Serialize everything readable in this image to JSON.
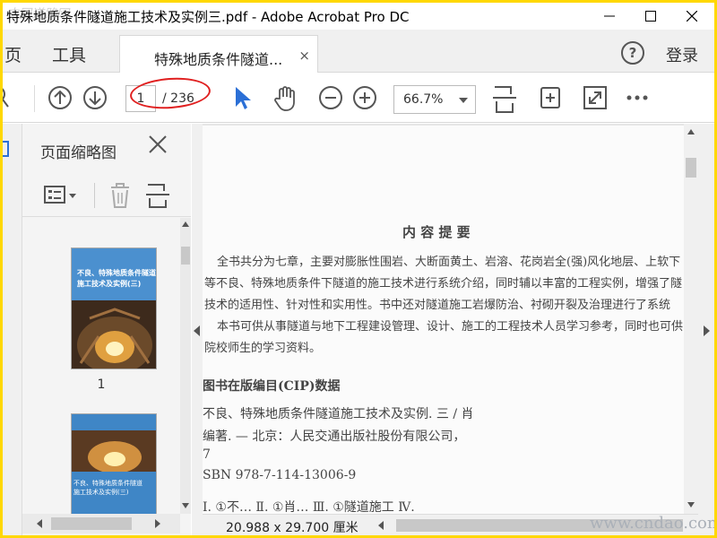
{
  "window": {
    "title": "特殊地质条件隧道施工技术及实例三.pdf - Adobe Acrobat Pro DC"
  },
  "menu": {
    "home": "页",
    "tools": "工具",
    "sign_in": "登录",
    "help": "?"
  },
  "tab": {
    "label": "特殊地质条件隧道...",
    "close": "×"
  },
  "toolbar": {
    "current_page": "1",
    "total_pages": "/ 236",
    "zoom": "66.7%"
  },
  "panel": {
    "title": "页面缩略图",
    "thumbnails": [
      {
        "page": "1",
        "title_line1": "不良、特殊地质条件隧道",
        "title_line2": "施工技术及实例(三)"
      },
      {
        "title_line1": "不良、特殊地质条件隧道",
        "title_line2": "施工技术及实例(三)"
      }
    ]
  },
  "document": {
    "heading": "内  容  提  要",
    "summary_lines": [
      "全书共分为七章，主要对膨胀性围岩、大断面黄土、岩溶、花岗岩全(强)风化地层、上软下",
      "等不良、特殊地质条件下隧道的施工技术进行系统介绍，同时辅以丰富的工程实例，增强了隧",
      "技术的适用性、针对性和实用性。书中还对隧道施工岩爆防治、衬砌开裂及治理进行了系统",
      "本书可供从事隧道与地下工程建设管理、设计、施工的工程技术人员学习参考，同时也可供",
      "院校师生的学习资料。"
    ],
    "cip_heading": "图书在版编目(CIP)数据",
    "cip_lines": [
      "不良、特殊地质条件隧道施工技术及实例. 三 / 肖",
      "编著. — 北京：人民交通出版社股份有限公司，",
      "7",
      "SBN  978-7-114-13006-9",
      "Ⅰ. ①不…   Ⅱ. ①肖…   Ⅲ. ①隧道施工   Ⅳ."
    ]
  },
  "status": {
    "page_size": "20.988 x 29.700 厘米"
  },
  "watermarks": {
    "top_left": "中国道路网",
    "bottom_right": "www.cndao.com"
  },
  "colors": {
    "accent": "#2b6fd6",
    "annotation": "#e02020",
    "frame": "#ffd800"
  }
}
